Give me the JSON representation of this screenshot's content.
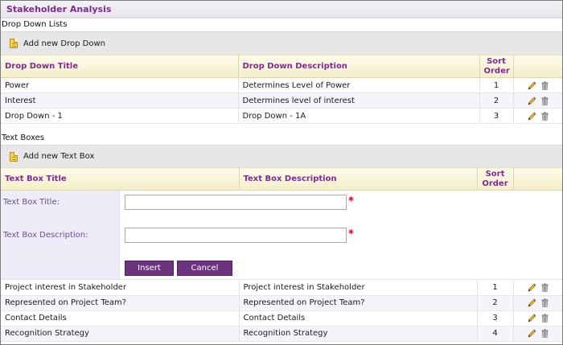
{
  "header": {
    "title": "Stakeholder Analysis"
  },
  "dropdowns": {
    "section_label": "Drop Down Lists",
    "add_label": "Add new Drop Down",
    "columns": {
      "title": "Drop Down Title",
      "description": "Drop Down Description",
      "sort": "Sort Order"
    },
    "rows": [
      {
        "title": "Power",
        "description": "Determines Level of Power",
        "sort": "1"
      },
      {
        "title": "Interest",
        "description": "Determines level of interest",
        "sort": "2"
      },
      {
        "title": "Drop Down - 1",
        "description": "Drop Down - 1A",
        "sort": "3"
      }
    ]
  },
  "textboxes": {
    "section_label": "Text Boxes",
    "add_label": "Add new Text Box",
    "columns": {
      "title": "Text Box Title",
      "description": "Text Box Description",
      "sort": "Sort Order"
    },
    "form": {
      "title_label": "Text Box Title:",
      "description_label": "Text Box Description:",
      "title_value": "",
      "description_value": "",
      "required_marker": "*",
      "insert_label": "Insert",
      "cancel_label": "Cancel"
    },
    "rows": [
      {
        "title": "Project interest in Stakeholder",
        "description": "Project interest in Stakeholder",
        "sort": "1"
      },
      {
        "title": "Represented on Project Team?",
        "description": "Represented on Project Team?",
        "sort": "2"
      },
      {
        "title": "Contact Details",
        "description": "Contact Details",
        "sort": "3"
      },
      {
        "title": "Recognition Strategy",
        "description": "Recognition Strategy",
        "sort": "4"
      }
    ]
  },
  "colors": {
    "accent": "#7b2e8c",
    "button": "#6c347e",
    "required": "#d4001b"
  },
  "icons": {
    "add": "add-document-icon",
    "edit": "pencil-icon",
    "delete": "trash-icon"
  }
}
